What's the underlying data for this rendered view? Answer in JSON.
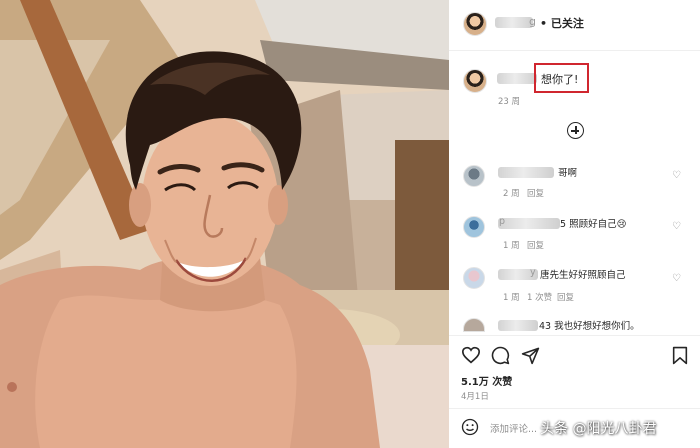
{
  "photo": {
    "description_icon": "portrait-photo"
  },
  "post_header": {
    "username": "g",
    "follow_status": "• 已关注"
  },
  "caption": {
    "text": "想你了!",
    "time": "23 周"
  },
  "load_more_icon": "plus-circle-icon",
  "comments": [
    {
      "username": "",
      "text": "哥啊",
      "time": "2 周",
      "reply": "回复",
      "likes": ""
    },
    {
      "username": "p",
      "text": "5 照顾好自己😢",
      "time": "1 周",
      "reply": "回复",
      "likes": ""
    },
    {
      "username": "y",
      "text": "唐先生好好照顾自己",
      "time": "1 周",
      "reply": "回复",
      "likes": "1 次赞"
    },
    {
      "username": "",
      "text": "43 我也好想好想你们。",
      "time": "",
      "reply": "",
      "likes": ""
    }
  ],
  "actions": {
    "like_icon": "heart-icon",
    "comment_icon": "comment-icon",
    "share_icon": "send-icon",
    "save_icon": "bookmark-icon"
  },
  "likes_count": "5.1万 次赞",
  "post_date": "4月1日",
  "add_comment_placeholder": "添加评论...",
  "watermark": "头条 @阳光八卦君",
  "colors": {
    "highlight": "#d0262f",
    "secondary_text": "#8e8e8e",
    "primary_text": "#262626"
  }
}
